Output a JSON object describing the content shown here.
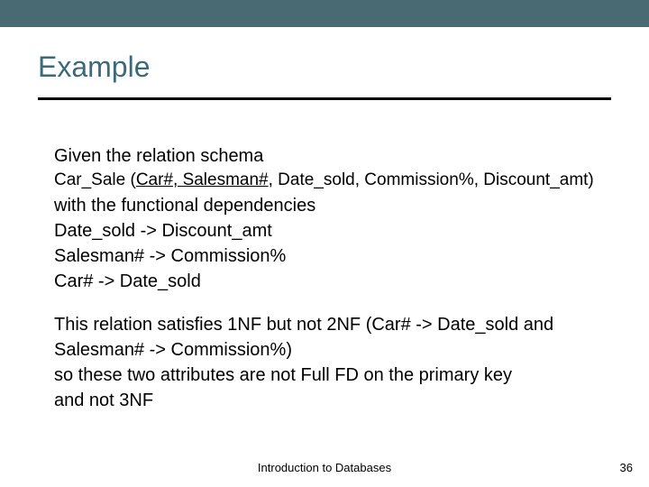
{
  "title": "Example",
  "body": {
    "line1": "Given the relation schema",
    "schema_prefix": "Car_Sale (",
    "schema_pk": "Car#, Salesman#",
    "schema_rest": ", Date_sold, Commission%, Discount_amt)",
    "line3": "with the functional dependencies",
    "fd1": "Date_sold -> Discount_amt",
    "fd2": "Salesman# -> Commission%",
    "fd3": "Car# -> Date_sold",
    "para2_l1": "This relation satisfies 1NF but not 2NF (Car# -> Date_sold and",
    "para2_l2": "Salesman# -> Commission%)",
    "para2_l3": "so these two attributes are not Full FD on the primary key",
    "para2_l4": "and not 3NF"
  },
  "footer": "Introduction to Databases",
  "page": "36"
}
